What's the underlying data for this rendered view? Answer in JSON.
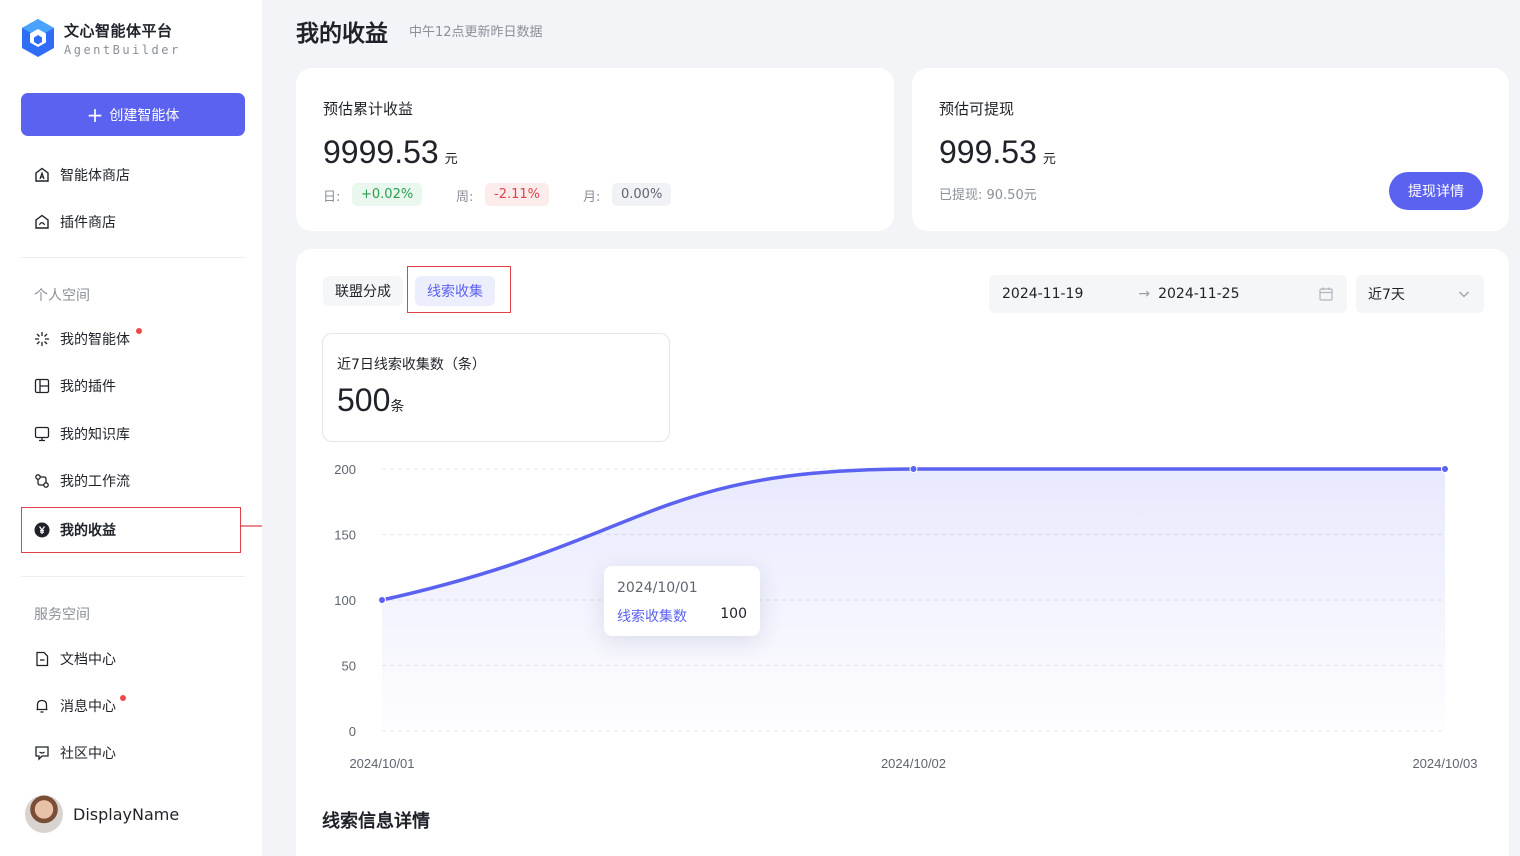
{
  "brand": {
    "title": "文心智能体平台",
    "subtitle": "AgentBuilder"
  },
  "sidebar": {
    "create_label": "创建智能体",
    "top_items": [
      {
        "label": "智能体商店",
        "icon": "agent-store-icon"
      },
      {
        "label": "插件商店",
        "icon": "plugin-store-icon"
      }
    ],
    "personal_title": "个人空间",
    "personal_items": [
      {
        "label": "我的智能体",
        "icon": "sparkle-icon",
        "badge": true
      },
      {
        "label": "我的插件",
        "icon": "plugin-icon",
        "badge": false
      },
      {
        "label": "我的知识库",
        "icon": "knowledge-icon",
        "badge": false
      },
      {
        "label": "我的工作流",
        "icon": "workflow-icon",
        "badge": false
      },
      {
        "label": "我的收益",
        "icon": "yen-icon",
        "badge": false,
        "active": true
      }
    ],
    "service_title": "服务空间",
    "service_items": [
      {
        "label": "文档中心",
        "icon": "document-icon",
        "badge": false
      },
      {
        "label": "消息中心",
        "icon": "bell-icon",
        "badge": true
      },
      {
        "label": "社区中心",
        "icon": "community-icon",
        "badge": false
      }
    ],
    "user_name": "DisplayName"
  },
  "page": {
    "title": "我的收益",
    "subtitle": "中午12点更新昨日数据"
  },
  "earnings_card": {
    "label": "预估累计收益",
    "value": "9999.53",
    "unit": "元",
    "day_label": "日:",
    "day_value": "+0.02%",
    "week_label": "周:",
    "week_value": "-2.11%",
    "month_label": "月:",
    "month_value": "0.00%"
  },
  "withdraw_card": {
    "label": "预估可提现",
    "value": "999.53",
    "unit": "元",
    "withdrawn_text": "已提现:  90.50元",
    "button_label": "提现详情"
  },
  "tabs": [
    {
      "label": "联盟分成",
      "active": false
    },
    {
      "label": "线索收集",
      "active": true
    }
  ],
  "date_range": {
    "start": "2024-11-19",
    "end": "2024-11-25",
    "arrow": "→"
  },
  "period_select": {
    "value": "近7天"
  },
  "stat_card": {
    "label": "近7日线索收集数（条）",
    "value": "500",
    "unit": "条"
  },
  "tooltip": {
    "date": "2024/10/01",
    "series": "线索收集数",
    "value": "100"
  },
  "details_heading": "线索信息详情",
  "chart_data": {
    "type": "area",
    "x": [
      "2024/10/01",
      "2024/10/02",
      "2024/10/03"
    ],
    "series": [
      {
        "name": "线索收集数",
        "values": [
          100,
          200,
          200
        ],
        "color": "#5b62f0"
      }
    ],
    "yticks": [
      0,
      50,
      100,
      150,
      200
    ],
    "ylim": [
      0,
      200
    ],
    "grid": true
  },
  "colors": {
    "accent": "#5b62f0",
    "danger": "#e0424a",
    "success": "#2c9e4f"
  }
}
